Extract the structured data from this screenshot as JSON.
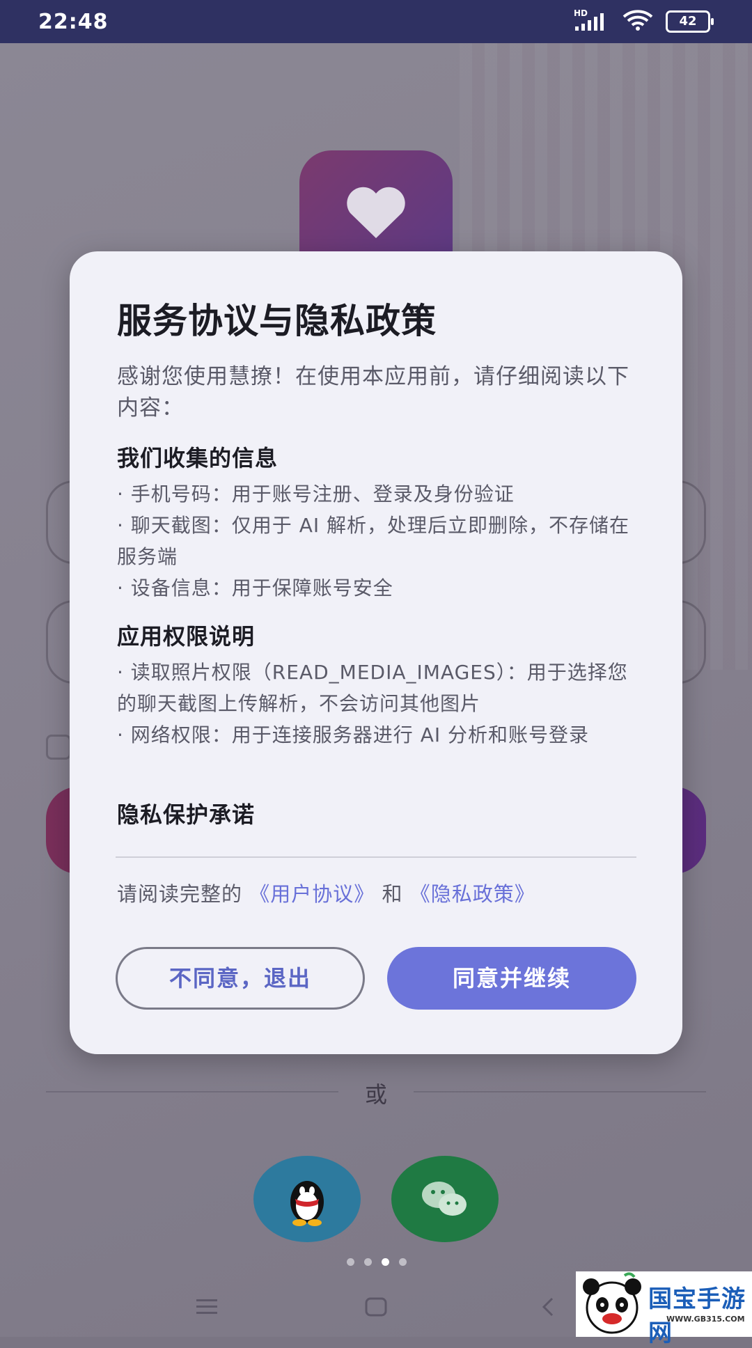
{
  "status_bar": {
    "time": "22:48",
    "network_label": "HD",
    "battery": "42"
  },
  "background": {
    "or_label": "或",
    "social_logins": [
      {
        "name": "qq-login",
        "icon": "qq-penguin-icon"
      },
      {
        "name": "wechat-login",
        "icon": "wechat-icon"
      }
    ],
    "page_indicator": {
      "count": 4,
      "active_index": 2
    }
  },
  "dialog": {
    "title": "服务协议与隐私政策",
    "intro": "感谢您使用慧撩！在使用本应用前，请仔细阅读以下内容：",
    "sections": [
      {
        "heading": "我们收集的信息",
        "lines": [
          "·  手机号码：用于账号注册、登录及身份验证",
          "·  聊天截图：仅用于 AI 解析，处理后立即删除，不存储在服务端",
          "·  设备信息：用于保障账号安全"
        ]
      },
      {
        "heading": "应用权限说明",
        "lines": [
          "·  读取照片权限（READ_MEDIA_IMAGES）：用于选择您的聊天截图上传解析，不会访问其他图片",
          "·  网络权限：用于连接服务器进行 AI 分析和账号登录"
        ]
      },
      {
        "heading": "隐私保护承诺",
        "lines": []
      }
    ],
    "links": {
      "prefix": "请阅读完整的",
      "user_agreement": "《用户协议》",
      "and": "和",
      "privacy_policy": "《隐私政策》"
    },
    "decline_label": "不同意，退出",
    "agree_label": "同意并继续",
    "accent_color": "#6c74da"
  },
  "watermark": {
    "text": "国宝手游网",
    "url": "WWW.GB315.COM"
  }
}
